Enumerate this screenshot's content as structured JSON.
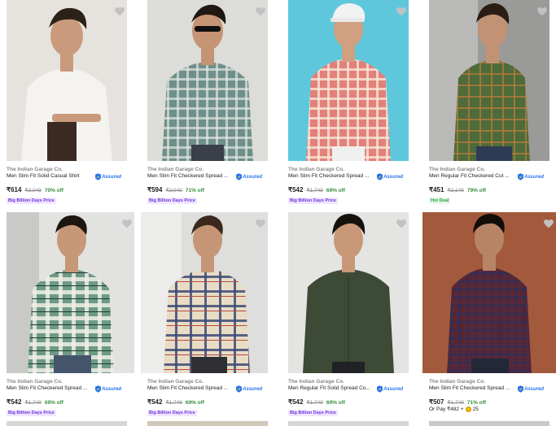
{
  "products": [
    {
      "brand": "The Indian Garage Co.",
      "title": "Men Slim Fit Solid Casual Shirt",
      "assured": "Assured",
      "price": "₹614",
      "mrp": "₹2,049",
      "off": "70% off",
      "tag": "Big Billion Days Price",
      "shirt_color": "#f4f3ef",
      "bg_color": "#e6e3de",
      "skin": "#c99a7c"
    },
    {
      "brand": "The Indian Garage Co.",
      "title": "Men Slim Fit Checkered Spread ...",
      "assured": "Assured",
      "price": "₹594",
      "mrp": "₹2,049",
      "off": "71% off",
      "tag": "Big Billion Days Price",
      "shirt_color": "#6f8f8a",
      "bg_color": "#dcdcd8",
      "skin": "#c49474"
    },
    {
      "brand": "The Indian Garage Co.",
      "title": "Men Slim Fit Checkered Spread ...",
      "assured": "Assured",
      "price": "₹542",
      "mrp": "₹1,749",
      "off": "69% off",
      "tag": "Big Billion Days Price",
      "shirt_color": "#e3807a",
      "bg_color": "#5fc7dc",
      "skin": "#d0a080"
    },
    {
      "brand": "The Indian Garage Co.",
      "title": "Men Regular Fit Checkered Cut ...",
      "assured": "Assured",
      "price": "₹451",
      "mrp": "₹2,149",
      "off": "79% off",
      "tag": "Hot Deal",
      "shirt_color": "#4e6b3a",
      "bg_color": "#9a9a98",
      "skin": "#c29274"
    },
    {
      "brand": "The Indian Garage Co.",
      "title": "Men Slim Fit Checkered Spread ...",
      "assured": "Assured",
      "price": "₹542",
      "mrp": "₹1,749",
      "off": "69% off",
      "tag": "Big Billion Days Price",
      "shirt_color": "#6c9a86",
      "bg_color": "#e2e2e0",
      "skin": "#c69878"
    },
    {
      "brand": "The Indian Garage Co.",
      "title": "Men Slim Fit Checkered Spread ...",
      "assured": "Assured",
      "price": "₹542",
      "mrp": "₹1,749",
      "off": "69% off",
      "tag": "Big Billion Days Price",
      "shirt_color": "#e8dcc4",
      "bg_color": "#dededc",
      "skin": "#c59676"
    },
    {
      "brand": "The Indian Garage Co.",
      "title": "Men Regular Fit Solid Spread Co...",
      "assured": "Assured",
      "price": "₹542",
      "mrp": "₹1,749",
      "off": "69% off",
      "tag": "Big Billion Days Price",
      "shirt_color": "#3d4a35",
      "bg_color": "#e4e4e2",
      "skin": "#c89878"
    },
    {
      "brand": "The Indian Garage Co.",
      "title": "Men Slim Fit Checkered Spread ...",
      "assured": "Assured",
      "price": "₹507",
      "mrp": "₹1,749",
      "off": "71% off",
      "tag": "",
      "shirt_color": "#5b2634",
      "bg_color": "#a35a3c",
      "skin": "#b88466"
    }
  ],
  "pay_option": {
    "text": "Or Pay ₹482 +",
    "coins": "25"
  },
  "colors": {
    "assured": "#2874f0",
    "discount": "#388e3c",
    "bbd_tag_bg": "#f1e6ff",
    "bbd_tag_text": "#6d36d9",
    "hot_tag_text": "#26a541",
    "heart": "#c2c2c2"
  }
}
